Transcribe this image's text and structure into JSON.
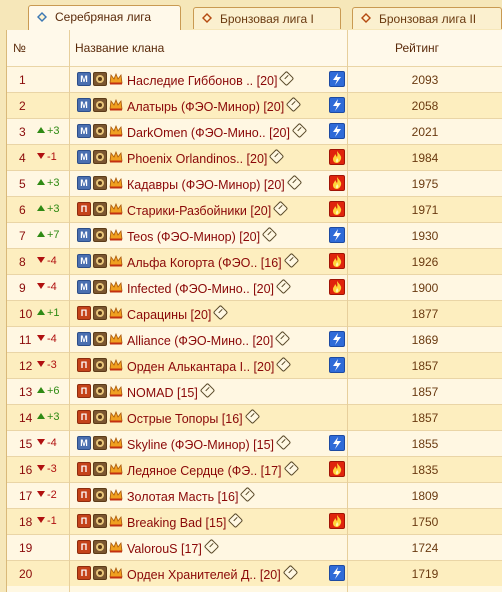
{
  "tabs": [
    {
      "label": "Серебряная лига",
      "active": true
    },
    {
      "label": "Бронзовая лига I",
      "active": false
    },
    {
      "label": "Бронзовая лига II",
      "active": false
    }
  ],
  "table": {
    "headers": {
      "num": "№",
      "clan": "Название клана",
      "rating": "Рейтинг"
    },
    "rows": [
      {
        "rank": "1",
        "change": "",
        "dir": "",
        "rank_icon": "M",
        "name": "Наследие Гиббонов .. [20]",
        "status": "lightning",
        "rating": "2093"
      },
      {
        "rank": "2",
        "change": "",
        "dir": "",
        "rank_icon": "M",
        "name": "Алатырь (ФЭО-Минор) [20]",
        "status": "lightning",
        "rating": "2058"
      },
      {
        "rank": "3",
        "change": "+3",
        "dir": "up",
        "rank_icon": "M",
        "name": "DarkOmen (ФЭО-Мино.. [20]",
        "status": "lightning",
        "rating": "2021"
      },
      {
        "rank": "4",
        "change": "-1",
        "dir": "down",
        "rank_icon": "M",
        "name": "Phoenix Orlandinos.. [20]",
        "status": "fire",
        "rating": "1984"
      },
      {
        "rank": "5",
        "change": "+3",
        "dir": "up",
        "rank_icon": "M",
        "name": "Кадавры (ФЭО-Минор) [20]",
        "status": "fire",
        "rating": "1975"
      },
      {
        "rank": "6",
        "change": "+3",
        "dir": "up",
        "rank_icon": "П",
        "name": "Старики-Разбойники [20]",
        "status": "fire",
        "rating": "1971"
      },
      {
        "rank": "7",
        "change": "+7",
        "dir": "up",
        "rank_icon": "M",
        "name": "Teos (ФЭО-Минор) [20]",
        "status": "lightning",
        "rating": "1930"
      },
      {
        "rank": "8",
        "change": "-4",
        "dir": "down",
        "rank_icon": "M",
        "name": "Альфа Когорта (ФЭО.. [16]",
        "status": "fire",
        "rating": "1926"
      },
      {
        "rank": "9",
        "change": "-4",
        "dir": "down",
        "rank_icon": "M",
        "name": "Infected (ФЭО-Мино.. [20]",
        "status": "fire",
        "rating": "1900"
      },
      {
        "rank": "10",
        "change": "+1",
        "dir": "up",
        "rank_icon": "П",
        "name": "Сарацины [20]",
        "status": "",
        "rating": "1877"
      },
      {
        "rank": "11",
        "change": "-4",
        "dir": "down",
        "rank_icon": "M",
        "name": "Alliance (ФЭО-Мино.. [20]",
        "status": "lightning",
        "rating": "1869"
      },
      {
        "rank": "12",
        "change": "-3",
        "dir": "down",
        "rank_icon": "П",
        "name": "Орден Алькантара I.. [20]",
        "status": "lightning",
        "rating": "1857"
      },
      {
        "rank": "13",
        "change": "+6",
        "dir": "up",
        "rank_icon": "П",
        "name": "NOMAD [15]",
        "status": "",
        "rating": "1857"
      },
      {
        "rank": "14",
        "change": "+3",
        "dir": "up",
        "rank_icon": "П",
        "name": "Острые Топоры [16]",
        "status": "",
        "rating": "1857"
      },
      {
        "rank": "15",
        "change": "-4",
        "dir": "down",
        "rank_icon": "M",
        "name": "Skyline (ФЭО-Минор) [15]",
        "status": "lightning",
        "rating": "1855"
      },
      {
        "rank": "16",
        "change": "-3",
        "dir": "down",
        "rank_icon": "П",
        "name": "Ледяное Сердце (ФЭ.. [17]",
        "status": "fire",
        "rating": "1835"
      },
      {
        "rank": "17",
        "change": "-2",
        "dir": "down",
        "rank_icon": "П",
        "name": "Золотая Масть [16]",
        "status": "",
        "rating": "1809"
      },
      {
        "rank": "18",
        "change": "-1",
        "dir": "down",
        "rank_icon": "П",
        "name": "Breaking Bad [15]",
        "status": "fire",
        "rating": "1750"
      },
      {
        "rank": "19",
        "change": "",
        "dir": "",
        "rank_icon": "П",
        "name": "ValorouS [17]",
        "status": "",
        "rating": "1724"
      },
      {
        "rank": "20",
        "change": "",
        "dir": "",
        "rank_icon": "П",
        "name": "Орден Хранителей Д.. [20]",
        "status": "lightning",
        "rating": "1719"
      }
    ]
  },
  "icons": {
    "tab_icon": "league-diamond-icon",
    "rank_M_color": "#4a6fb0",
    "rank_P_color": "#c4431a",
    "crown_color": "#f0a020",
    "info_icon": "info-diamond-icon",
    "lightning_color": "#2f6bd8",
    "fire_color": "#e0240c"
  }
}
